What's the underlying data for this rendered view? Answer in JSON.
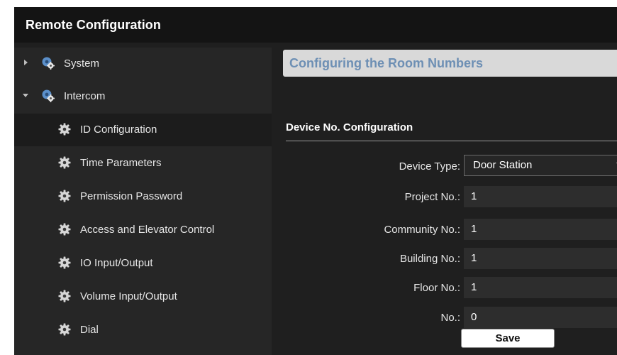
{
  "window": {
    "title": "Remote Configuration"
  },
  "sidebar": {
    "items": [
      {
        "label": "System",
        "icon": "settings-gear-icon",
        "expander": "collapsed"
      },
      {
        "label": "Intercom",
        "icon": "settings-gear-icon",
        "expander": "expanded"
      },
      {
        "label": "ID Configuration",
        "icon": "gear-icon",
        "selected": true
      },
      {
        "label": "Time Parameters",
        "icon": "gear-icon"
      },
      {
        "label": "Permission Password",
        "icon": "gear-icon"
      },
      {
        "label": "Access and Elevator Control",
        "icon": "gear-icon"
      },
      {
        "label": "IO Input/Output",
        "icon": "gear-icon"
      },
      {
        "label": "Volume Input/Output",
        "icon": "gear-icon"
      },
      {
        "label": "Dial",
        "icon": "gear-icon"
      }
    ]
  },
  "main": {
    "section_title": "Configuring the Room Numbers",
    "group_title": "Device No. Configuration",
    "fields": {
      "device_type": {
        "label": "Device Type:",
        "value": "Door Station"
      },
      "project_no": {
        "label": "Project No.:",
        "value": "1"
      },
      "community_no": {
        "label": "Community No.:",
        "value": "1"
      },
      "building_no": {
        "label": "Building No.:",
        "value": "1"
      },
      "floor_no": {
        "label": "Floor No.:",
        "value": "1"
      },
      "no": {
        "label": "No.:",
        "value": "0"
      }
    },
    "save_label": "Save"
  },
  "colors": {
    "window_bg": "#1f1f1f",
    "titlebar_bg": "#141414",
    "sidebar_bg": "#262626",
    "header_bg": "#d9d9d9",
    "header_text": "#6d8fb4",
    "field_bg": "#2d2d2d"
  }
}
